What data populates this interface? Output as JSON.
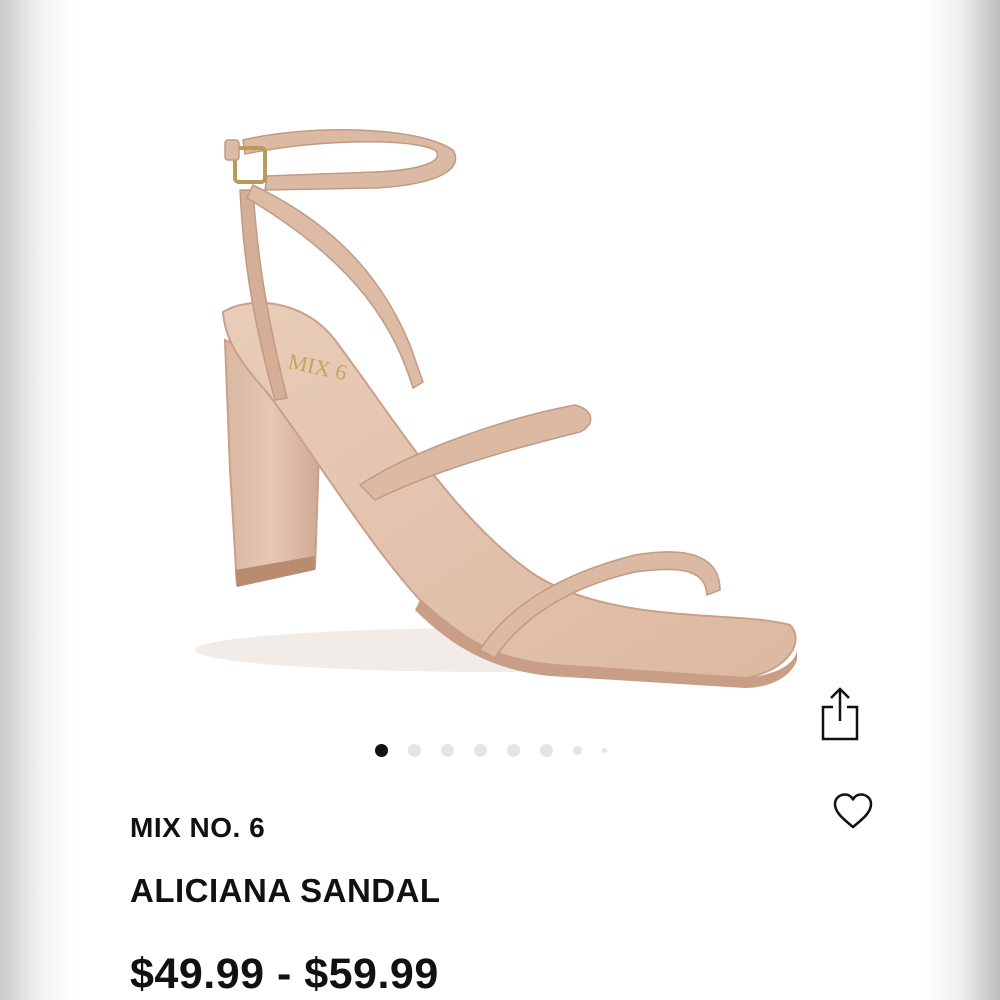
{
  "product": {
    "brand": "MIX NO. 6",
    "name": "ALICIANA SANDAL",
    "price_range": "$49.99 - $59.99",
    "image_logo_text": "MIX 6"
  },
  "carousel": {
    "total_images": 8,
    "active_index": 0
  },
  "icons": {
    "share": "share-icon",
    "favorite": "heart-icon"
  },
  "colors": {
    "sandal_nude": "#dcb8a0",
    "text": "#111111",
    "dot_active": "#111111",
    "dot_inactive": "#e4e4e4"
  }
}
